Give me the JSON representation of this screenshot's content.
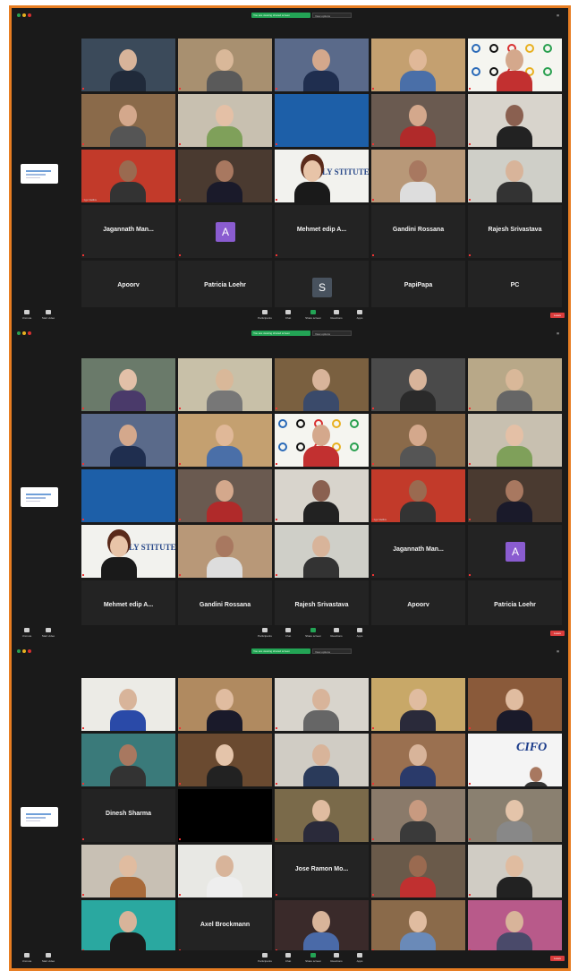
{
  "colors": {
    "frame": "#e77d22",
    "meeting_bg": "#1a1a1a",
    "green_banner": "#23a455",
    "end_button": "#d93c3c",
    "avatar_purple": "#8a5cd0",
    "avatar_gray": "#48525e"
  },
  "toolbar": {
    "items": [
      {
        "label": "Unmute",
        "icon": "mic-icon"
      },
      {
        "label": "Start video",
        "icon": "camera-icon"
      },
      {
        "label": "Participants",
        "icon": "participants-icon"
      },
      {
        "label": "Chat",
        "icon": "chat-icon"
      },
      {
        "label": "Share screen",
        "icon": "share-icon"
      },
      {
        "label": "Reactions",
        "icon": "reactions-icon"
      },
      {
        "label": "Apps",
        "icon": "apps-icon"
      }
    ],
    "end_label": "Leave"
  },
  "panels": [
    {
      "banner": "You are viewing shared screen",
      "banner2": "View options",
      "tiles": [
        {
          "type": "video",
          "caption": "",
          "bg": "#3b4a5a",
          "skin": "#d8b49a",
          "shirt": "#202a3a"
        },
        {
          "type": "video",
          "caption": "",
          "bg": "#a89070",
          "skin": "#d9b899",
          "shirt": "#5a5a5a"
        },
        {
          "type": "video",
          "caption": "",
          "bg": "#5a6a8a",
          "skin": "#d4a88c",
          "shirt": "#1f2e4f"
        },
        {
          "type": "video",
          "caption": "",
          "bg": "#c4a070",
          "skin": "#e0b898",
          "shirt": "#4a6fa8"
        },
        {
          "type": "olympic",
          "caption": "",
          "skin": "#d4a88c",
          "shirt": "#c23030"
        },
        {
          "type": "video",
          "caption": "",
          "bg": "#8a6a4a",
          "skin": "#d4a88c",
          "shirt": "#555"
        },
        {
          "type": "video",
          "caption": "",
          "bg": "#c8c0b0",
          "skin": "#e4c0a6",
          "shirt": "#7fa05a"
        },
        {
          "type": "blue",
          "caption": "",
          "bg": "#1d5fa8"
        },
        {
          "type": "video",
          "caption": "",
          "bg": "#6a5a50",
          "skin": "#d4a88c",
          "shirt": "#b02a2a"
        },
        {
          "type": "video",
          "caption": "",
          "bg": "#d8d4cc",
          "skin": "#8a6050",
          "shirt": "#222"
        },
        {
          "type": "video",
          "caption": "Ugo Vadivu",
          "bg": "#c23a2a",
          "skin": "#9a6a50",
          "shirt": "#333"
        },
        {
          "type": "video",
          "caption": "",
          "bg": "#4a3a30",
          "skin": "#a87860",
          "shirt": "#1a1a2a"
        },
        {
          "type": "oly-woman",
          "caption": "",
          "text": "OLY  STITUTE",
          "skin": "#e8c4a8",
          "shirt": "#1a1a1a"
        },
        {
          "type": "video",
          "caption": "",
          "bg": "#b89878",
          "skin": "#a87860",
          "shirt": "#ddd"
        },
        {
          "type": "video",
          "caption": "",
          "bg": "#cfcfc8",
          "skin": "#d8b49a",
          "shirt": "#333"
        },
        {
          "type": "name",
          "name": "Jagannath  Man...",
          "caption": ""
        },
        {
          "type": "avatar",
          "letter": "A",
          "avatar_color": "#8a5cd0",
          "caption": ""
        },
        {
          "type": "name",
          "name": "Mehmet edip A...",
          "caption": ""
        },
        {
          "type": "name",
          "name": "Gandini Rossana",
          "caption": ""
        },
        {
          "type": "name",
          "name": "Rajesh Srivastava",
          "caption": ""
        },
        {
          "type": "name",
          "name": "Apoorv",
          "caption": ""
        },
        {
          "type": "name",
          "name": "Patricia Loehr",
          "caption": ""
        },
        {
          "type": "avatar",
          "letter": "S",
          "avatar_color": "#48525e",
          "caption": ""
        },
        {
          "type": "name",
          "name": "PapiPapa",
          "caption": ""
        },
        {
          "type": "name",
          "name": "PC",
          "caption": ""
        }
      ]
    },
    {
      "banner": "You are viewing shared screen",
      "banner2": "View options",
      "tiles": [
        {
          "type": "video",
          "caption": "",
          "bg": "#6a7a6a",
          "skin": "#e2c0a8",
          "shirt": "#4a3a6a"
        },
        {
          "type": "video",
          "caption": "",
          "bg": "#c8c0a8",
          "skin": "#d9b899",
          "shirt": "#777"
        },
        {
          "type": "video",
          "caption": "",
          "bg": "#7a6040",
          "skin": "#d8b49a",
          "shirt": "#3a4a6a"
        },
        {
          "type": "video",
          "caption": "",
          "bg": "#4a4a4a",
          "skin": "#d8b49a",
          "shirt": "#2a2a2a"
        },
        {
          "type": "video",
          "caption": "",
          "bg": "#b8a888",
          "skin": "#d9b899",
          "shirt": "#666"
        },
        {
          "type": "video",
          "caption": "",
          "bg": "#5a6a8a",
          "skin": "#d4a88c",
          "shirt": "#1f2e4f"
        },
        {
          "type": "video",
          "caption": "",
          "bg": "#c4a070",
          "skin": "#e0b898",
          "shirt": "#4a6fa8"
        },
        {
          "type": "olympic",
          "caption": "",
          "skin": "#d4a88c",
          "shirt": "#c23030"
        },
        {
          "type": "video",
          "caption": "",
          "bg": "#8a6a4a",
          "skin": "#d4a88c",
          "shirt": "#555"
        },
        {
          "type": "video",
          "caption": "",
          "bg": "#c8c0b0",
          "skin": "#e4c0a6",
          "shirt": "#7fa05a"
        },
        {
          "type": "blue",
          "caption": "",
          "bg": "#1d5fa8"
        },
        {
          "type": "video",
          "caption": "",
          "bg": "#6a5a50",
          "skin": "#d4a88c",
          "shirt": "#b02a2a"
        },
        {
          "type": "video",
          "caption": "",
          "bg": "#d8d4cc",
          "skin": "#8a6050",
          "shirt": "#222"
        },
        {
          "type": "video",
          "caption": "Ugo Vadivu",
          "bg": "#c23a2a",
          "skin": "#9a6a50",
          "shirt": "#333"
        },
        {
          "type": "video",
          "caption": "",
          "bg": "#4a3a30",
          "skin": "#a87860",
          "shirt": "#1a1a2a"
        },
        {
          "type": "oly-woman",
          "caption": "",
          "text": "OLY  STITUTE",
          "skin": "#e8c4a8",
          "shirt": "#1a1a1a"
        },
        {
          "type": "video",
          "caption": "",
          "bg": "#b89878",
          "skin": "#a87860",
          "shirt": "#ddd"
        },
        {
          "type": "video",
          "caption": "",
          "bg": "#cfcfc8",
          "skin": "#d8b49a",
          "shirt": "#333"
        },
        {
          "type": "name",
          "name": "Jagannath  Man...",
          "caption": ""
        },
        {
          "type": "avatar",
          "letter": "A",
          "avatar_color": "#8a5cd0",
          "caption": ""
        },
        {
          "type": "name",
          "name": "Mehmet edip A...",
          "caption": ""
        },
        {
          "type": "name",
          "name": "Gandini Rossana",
          "caption": ""
        },
        {
          "type": "name",
          "name": "Rajesh Srivastava",
          "caption": ""
        },
        {
          "type": "name",
          "name": "Apoorv",
          "caption": ""
        },
        {
          "type": "name",
          "name": "Patricia Loehr",
          "caption": ""
        }
      ]
    },
    {
      "banner": "You are viewing shared screen",
      "banner2": "View options",
      "tiles": [
        {
          "type": "video",
          "caption": "",
          "bg": "#ecebe6",
          "skin": "#d8b49a",
          "shirt": "#2a4aa8"
        },
        {
          "type": "video",
          "caption": "",
          "bg": "#b08a60",
          "skin": "#e0bca0",
          "shirt": "#1a1a2a"
        },
        {
          "type": "video",
          "caption": "",
          "bg": "#d8d4cc",
          "skin": "#d8b49a",
          "shirt": "#666"
        },
        {
          "type": "video",
          "caption": "",
          "bg": "#c8a868",
          "skin": "#e0bca0",
          "shirt": "#2a2a3a"
        },
        {
          "type": "video",
          "caption": "",
          "bg": "#8a5a3a",
          "skin": "#e0bca0",
          "shirt": "#1a1a2a"
        },
        {
          "type": "video",
          "caption": "",
          "bg": "#3a7a7a",
          "skin": "#a87860",
          "shirt": "#333"
        },
        {
          "type": "video",
          "caption": "",
          "bg": "#6a4a30",
          "skin": "#e4c4aa",
          "shirt": "#222"
        },
        {
          "type": "video",
          "caption": "",
          "bg": "#d0ccc4",
          "skin": "#d8b49a",
          "shirt": "#2a3a5a"
        },
        {
          "type": "video",
          "caption": "",
          "bg": "#9a7050",
          "skin": "#d8b49a",
          "shirt": "#2a3a6a"
        },
        {
          "type": "cifo",
          "caption": "",
          "text": "CIFO",
          "skin": "#a87860",
          "shirt": "#333"
        },
        {
          "type": "name",
          "name": "Dinesh Sharma",
          "caption": ""
        },
        {
          "type": "black",
          "caption": ""
        },
        {
          "type": "video",
          "caption": "",
          "bg": "#7a6a4a",
          "skin": "#e0bca0",
          "shirt": "#2a2a3a"
        },
        {
          "type": "video",
          "caption": "",
          "bg": "#8a7a6a",
          "skin": "#c89a80",
          "shirt": "#3a3a3a"
        },
        {
          "type": "video",
          "caption": "",
          "bg": "#8a8070",
          "skin": "#e4c4aa",
          "shirt": "#888"
        },
        {
          "type": "video",
          "caption": "",
          "bg": "#c8c0b4",
          "skin": "#e0bca0",
          "shirt": "#a86a3a"
        },
        {
          "type": "video",
          "caption": "",
          "bg": "#e8e8e4",
          "skin": "#d8b49a",
          "shirt": "#eee"
        },
        {
          "type": "name",
          "name": "Jose Ramon Mo...",
          "caption": ""
        },
        {
          "type": "video",
          "caption": "",
          "bg": "#6a5a4a",
          "skin": "#9a6a50",
          "shirt": "#c03030"
        },
        {
          "type": "video",
          "caption": "",
          "bg": "#d0ccc4",
          "skin": "#e0bca0",
          "shirt": "#222"
        },
        {
          "type": "video",
          "caption": "",
          "bg": "#2aa8a0",
          "skin": "#d8b49a",
          "shirt": "#1a1a1a"
        },
        {
          "type": "name",
          "name": "Axel Brockmann",
          "caption": ""
        },
        {
          "type": "video",
          "caption": "",
          "bg": "#3a2a2a",
          "skin": "#d8b49a",
          "shirt": "#4a6aa8"
        },
        {
          "type": "video",
          "caption": "",
          "bg": "#8a6a4a",
          "skin": "#e0bca0",
          "shirt": "#6a8ab8"
        },
        {
          "type": "video",
          "caption": "",
          "bg": "#b85a8a",
          "skin": "#d8b49a",
          "shirt": "#4a4a6a"
        }
      ]
    }
  ]
}
